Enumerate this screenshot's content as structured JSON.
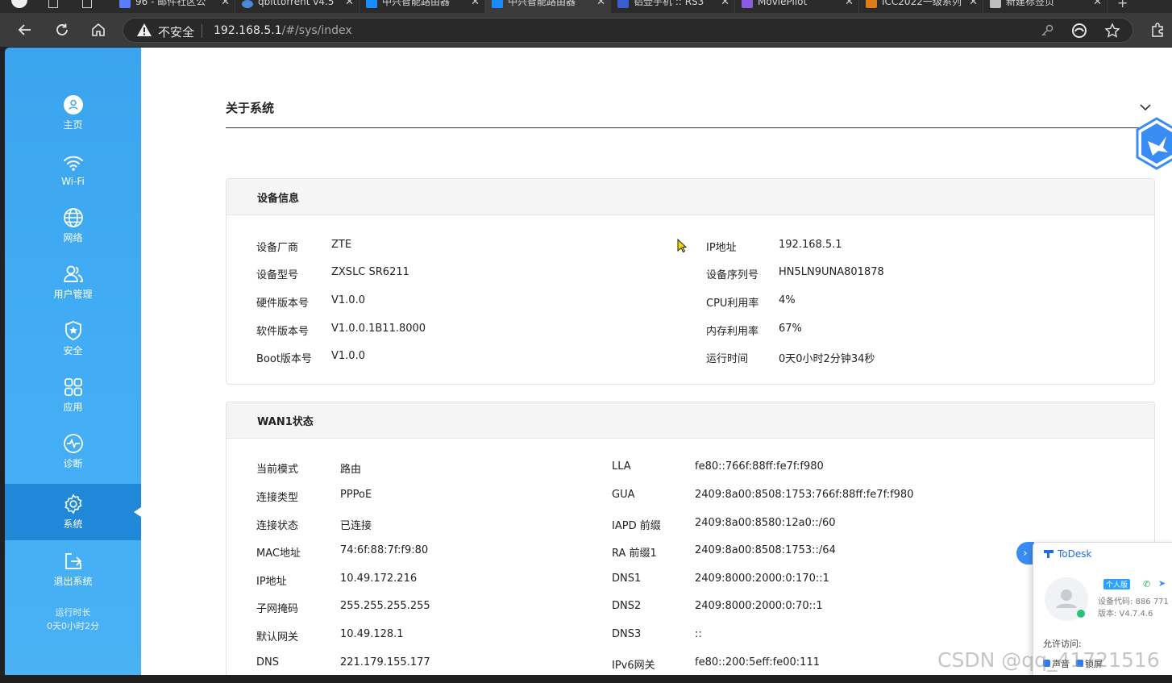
{
  "browser": {
    "tabs": [
      {
        "title": "96 - 邮件社区公"
      },
      {
        "title": "qbittorrent v4.5"
      },
      {
        "title": "中兴智能路由器"
      },
      {
        "title": "中兴智能路由器"
      },
      {
        "title": "铝壶手机 :: RS3"
      },
      {
        "title": "MoviePilot"
      },
      {
        "title": "ICC2022一级系列"
      },
      {
        "title": "新建标签页"
      }
    ],
    "security_label": "不安全",
    "url_host": "192.168.5.1",
    "url_path": "/#/sys/index"
  },
  "sidebar": {
    "items": [
      {
        "label": "主页",
        "icon": "user-circle-icon"
      },
      {
        "label": "Wi-Fi",
        "icon": "wifi-icon"
      },
      {
        "label": "网络",
        "icon": "globe-icon"
      },
      {
        "label": "用户管理",
        "icon": "users-icon"
      },
      {
        "label": "安全",
        "icon": "shield-icon"
      },
      {
        "label": "应用",
        "icon": "apps-grid-icon"
      },
      {
        "label": "诊断",
        "icon": "pulse-icon"
      },
      {
        "label": "系统",
        "icon": "gear-icon"
      },
      {
        "label": "退出系统",
        "icon": "logout-icon"
      }
    ],
    "active_item": "系统",
    "runtime_label": "运行时长",
    "runtime_value": "0天0小时2分"
  },
  "main": {
    "section_title": "关于系统",
    "device_card": {
      "title": "设备信息",
      "left": [
        {
          "label": "设备厂商",
          "value": "ZTE"
        },
        {
          "label": "设备型号",
          "value": "ZXSLC SR6211"
        },
        {
          "label": "硬件版本号",
          "value": "V1.0.0"
        },
        {
          "label": "软件版本号",
          "value": "V1.0.0.1B11.8000"
        },
        {
          "label": "Boot版本号",
          "value": "V1.0.0"
        }
      ],
      "right": [
        {
          "label": "IP地址",
          "value": "192.168.5.1"
        },
        {
          "label": "设备序列号",
          "value": "HN5LN9UNA801878"
        },
        {
          "label": "CPU利用率",
          "value": "4%"
        },
        {
          "label": "内存利用率",
          "value": "67%"
        },
        {
          "label": "运行时间",
          "value": "0天0小时2分钟34秒"
        }
      ]
    },
    "wan_card": {
      "title": "WAN1状态",
      "left": [
        {
          "label": "当前模式",
          "value": "路由"
        },
        {
          "label": "连接类型",
          "value": "PPPoE"
        },
        {
          "label": "连接状态",
          "value": "已连接"
        },
        {
          "label": "MAC地址",
          "value": "74:6f:88:7f:f9:80"
        },
        {
          "label": "IP地址",
          "value": "10.49.172.216"
        },
        {
          "label": "子网掩码",
          "value": "255.255.255.255"
        },
        {
          "label": "默认网关",
          "value": "10.49.128.1"
        },
        {
          "label": "DNS",
          "value": "221.179.155.177"
        }
      ],
      "right": [
        {
          "label": "LLA",
          "value": "fe80::766f:88ff:fe7f:f980"
        },
        {
          "label": "GUA",
          "value": "2409:8a00:8508:1753:766f:88ff:fe7f:f980"
        },
        {
          "label": "IAPD 前缀",
          "value": "2409:8a00:8580:12a0::/60"
        },
        {
          "label": "RA 前缀1",
          "value": "2409:8a00:8508:1753::/64"
        },
        {
          "label": "DNS1",
          "value": "2409:8000:2000:0:170::1"
        },
        {
          "label": "DNS2",
          "value": "2409:8000:2000:0:70::1"
        },
        {
          "label": "DNS3",
          "value": "::"
        },
        {
          "label": "IPv6网关",
          "value": "fe80::200:5eff:fe00:111"
        }
      ]
    }
  },
  "todesk": {
    "brand": "ToDesk",
    "badge": "个人版",
    "device_code": "设备代码: 886 771",
    "version": "版本: V4.7.4.6",
    "allow_label": "允许访问:",
    "opt1": "声音",
    "opt2": "锁屏"
  },
  "watermark": "CSDN @qq_41721516",
  "colors": {
    "sidebar": "#42adf4",
    "sidebar_active": "#1f88d8",
    "accent": "#1f6fe0"
  }
}
